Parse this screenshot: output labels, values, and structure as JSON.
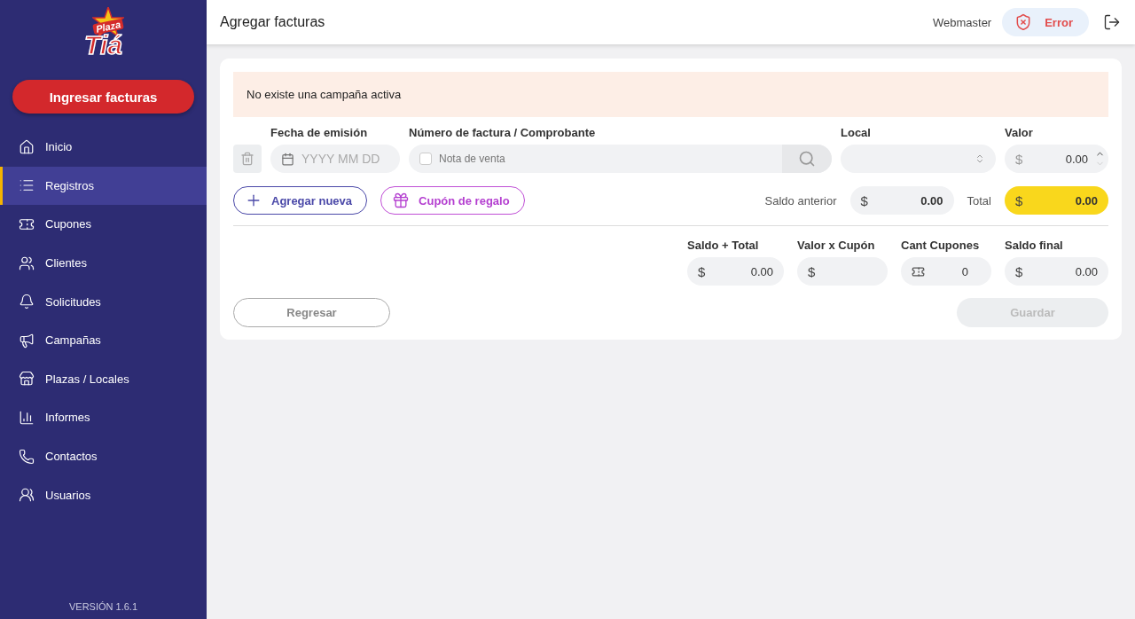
{
  "sidebar": {
    "logo": {
      "top": "Plaza",
      "bottom": "Tiá"
    },
    "primary_button": "Ingresar facturas",
    "items": [
      {
        "label": "Inicio",
        "selected": false
      },
      {
        "label": "Registros",
        "selected": true
      },
      {
        "label": "Cupones",
        "selected": false
      },
      {
        "label": "Clientes",
        "selected": false
      },
      {
        "label": "Solicitudes",
        "selected": false
      },
      {
        "label": "Campañas",
        "selected": false
      },
      {
        "label": "Plazas / Locales",
        "selected": false
      },
      {
        "label": "Informes",
        "selected": false
      },
      {
        "label": "Contactos",
        "selected": false
      },
      {
        "label": "Usuarios",
        "selected": false
      }
    ],
    "version": "VERSIÓN 1.6.1"
  },
  "header": {
    "title": "Agregar facturas",
    "user": "Webmaster",
    "status": "Error"
  },
  "alert": "No existe una campaña activa",
  "invoice_row": {
    "date": {
      "label": "Fecha de emisión",
      "placeholder": "YYYY MM DD"
    },
    "number": {
      "label": "Número de factura / Comprobante",
      "checkbox_label": "Nota de venta",
      "checked": false
    },
    "local": {
      "label": "Local"
    },
    "valor": {
      "label": "Valor",
      "currency": "$",
      "value": "0.00"
    }
  },
  "actions": [
    {
      "label": "Agregar nueva",
      "kind": "add"
    },
    {
      "label": "Cupón de regalo",
      "kind": "gift"
    }
  ],
  "totals": [
    {
      "label": "Saldo anterior",
      "currency": "$",
      "value": "0.00",
      "highlight": false
    },
    {
      "label": "Total",
      "currency": "$",
      "value": "0.00",
      "highlight": true
    }
  ],
  "summary": [
    {
      "label": "Saldo + Total",
      "kind": "money",
      "prefix": "$",
      "value": "0.00"
    },
    {
      "label": "Valor x Cupón",
      "kind": "money",
      "prefix": "$"
    },
    {
      "label": "Cant Cupones",
      "kind": "ticket",
      "value": "0"
    },
    {
      "label": "Saldo final",
      "kind": "money",
      "prefix": "$",
      "value": "0.00"
    }
  ],
  "footer_buttons": [
    {
      "label": "Regresar",
      "kind": "back",
      "disabled": false
    },
    {
      "label": "Guardar",
      "kind": "save",
      "disabled": true
    }
  ]
}
